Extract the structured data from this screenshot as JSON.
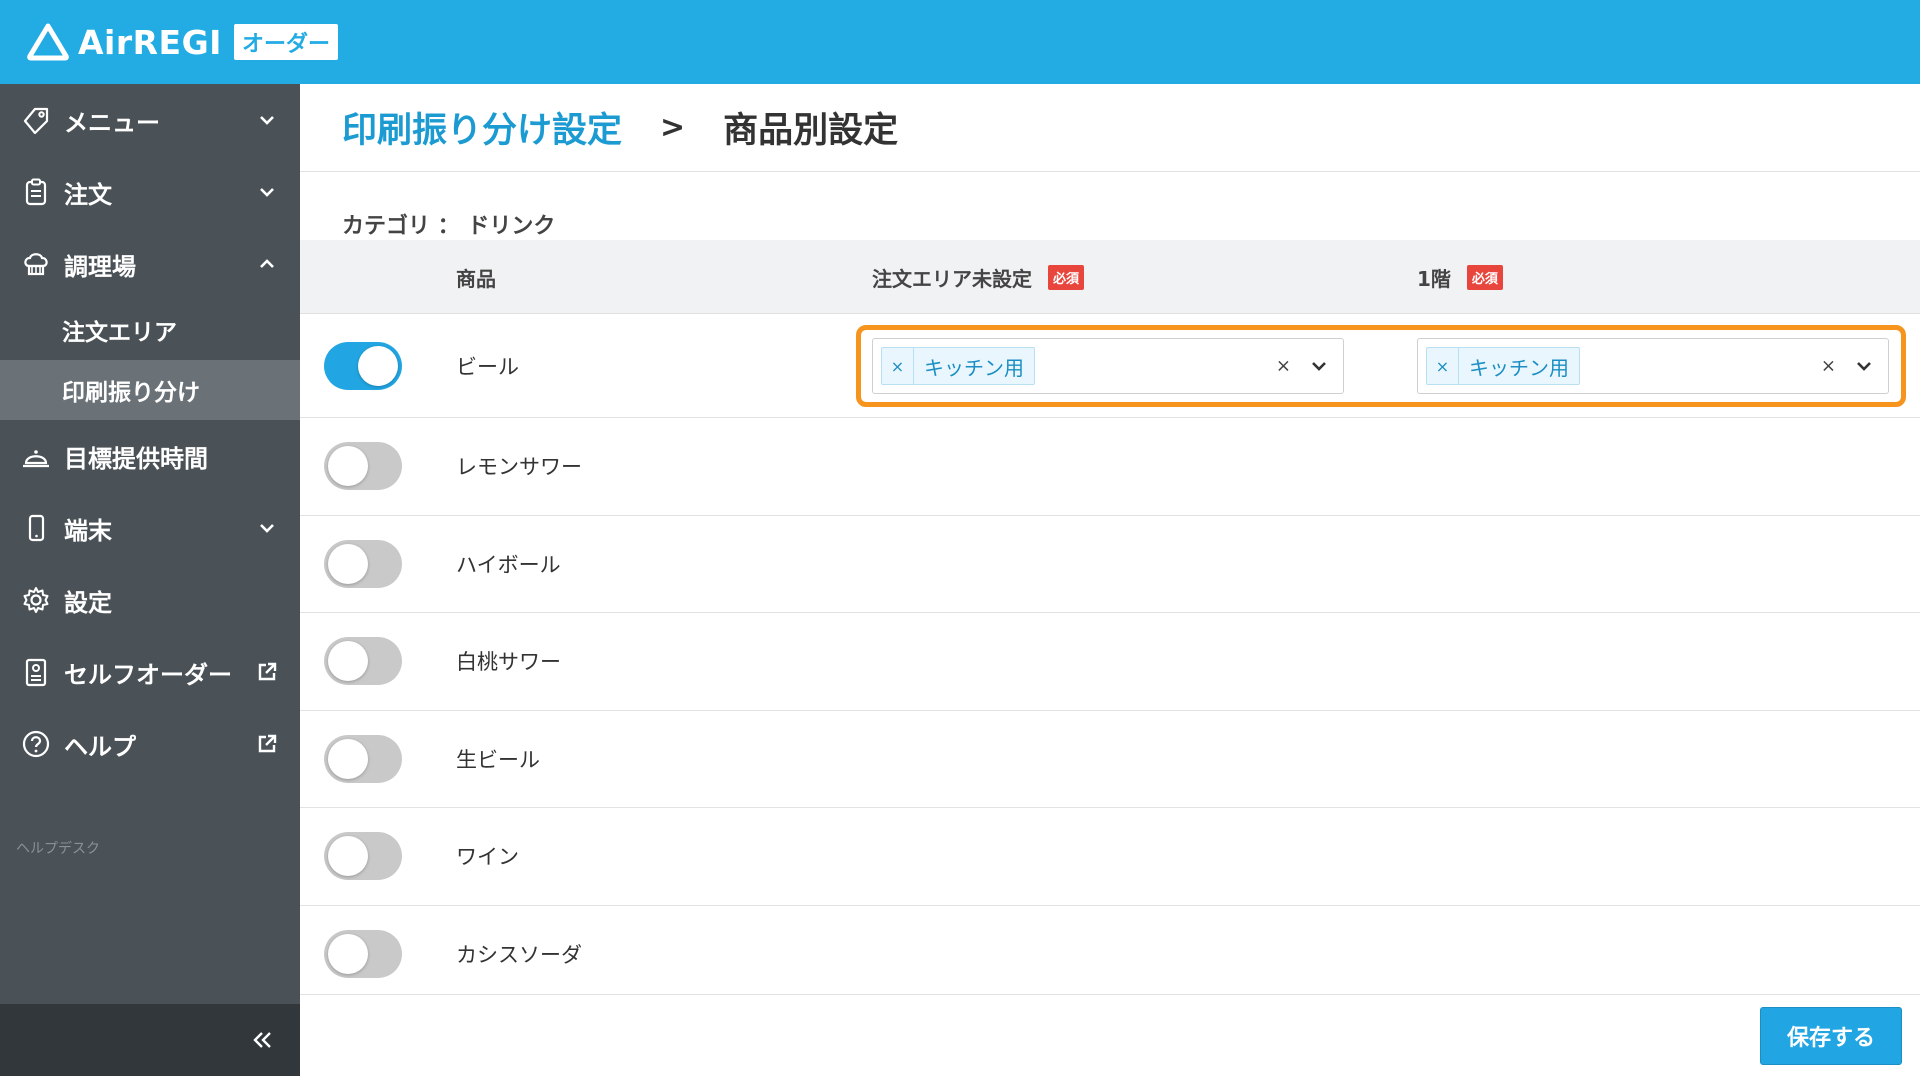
{
  "app": {
    "logo_text": "AirREGI",
    "logo_badge": "オーダー"
  },
  "colors": {
    "brand": "#22ace3",
    "sidebar": "#4b5257",
    "highlight": "#f7941d",
    "required": "#e8453c",
    "toggle_on": "#22a6e3"
  },
  "sidebar": {
    "items": [
      {
        "label": "メニュー",
        "icon": "tag-icon"
      },
      {
        "label": "注文",
        "icon": "clipboard-icon"
      },
      {
        "label": "調理場",
        "icon": "chef-hat-icon",
        "sub": [
          {
            "label": "注文エリア"
          },
          {
            "label": "印刷振り分け",
            "active": true
          }
        ]
      },
      {
        "label": "目標提供時間",
        "icon": "cloche-icon"
      },
      {
        "label": "端末",
        "icon": "phone-icon"
      },
      {
        "label": "設定",
        "icon": "gear-icon"
      },
      {
        "label": "セルフオーダー",
        "icon": "order-card-icon"
      },
      {
        "label": "ヘルプ",
        "icon": "help-icon"
      }
    ],
    "helpdesk": "ヘルプデスク"
  },
  "header": {
    "crumb_link": "印刷振り分け設定",
    "separator": ">",
    "current": "商品別設定"
  },
  "category_label": "カテゴリ ： ドリンク",
  "table": {
    "headers": {
      "product": "商品",
      "area_unset": "注文エリア未設定",
      "floor1": "1階",
      "required": "必須"
    },
    "rows": [
      {
        "name": "ビール",
        "enabled": true,
        "area_unset": "キッチン用",
        "floor1": "キッチン用"
      },
      {
        "name": "レモンサワー",
        "enabled": false
      },
      {
        "name": "ハイボール",
        "enabled": false
      },
      {
        "name": "白桃サワー",
        "enabled": false
      },
      {
        "name": "生ビール",
        "enabled": false
      },
      {
        "name": "ワイン",
        "enabled": false
      },
      {
        "name": "カシスソーダ",
        "enabled": false
      }
    ]
  },
  "footer": {
    "save_label": "保存する"
  }
}
